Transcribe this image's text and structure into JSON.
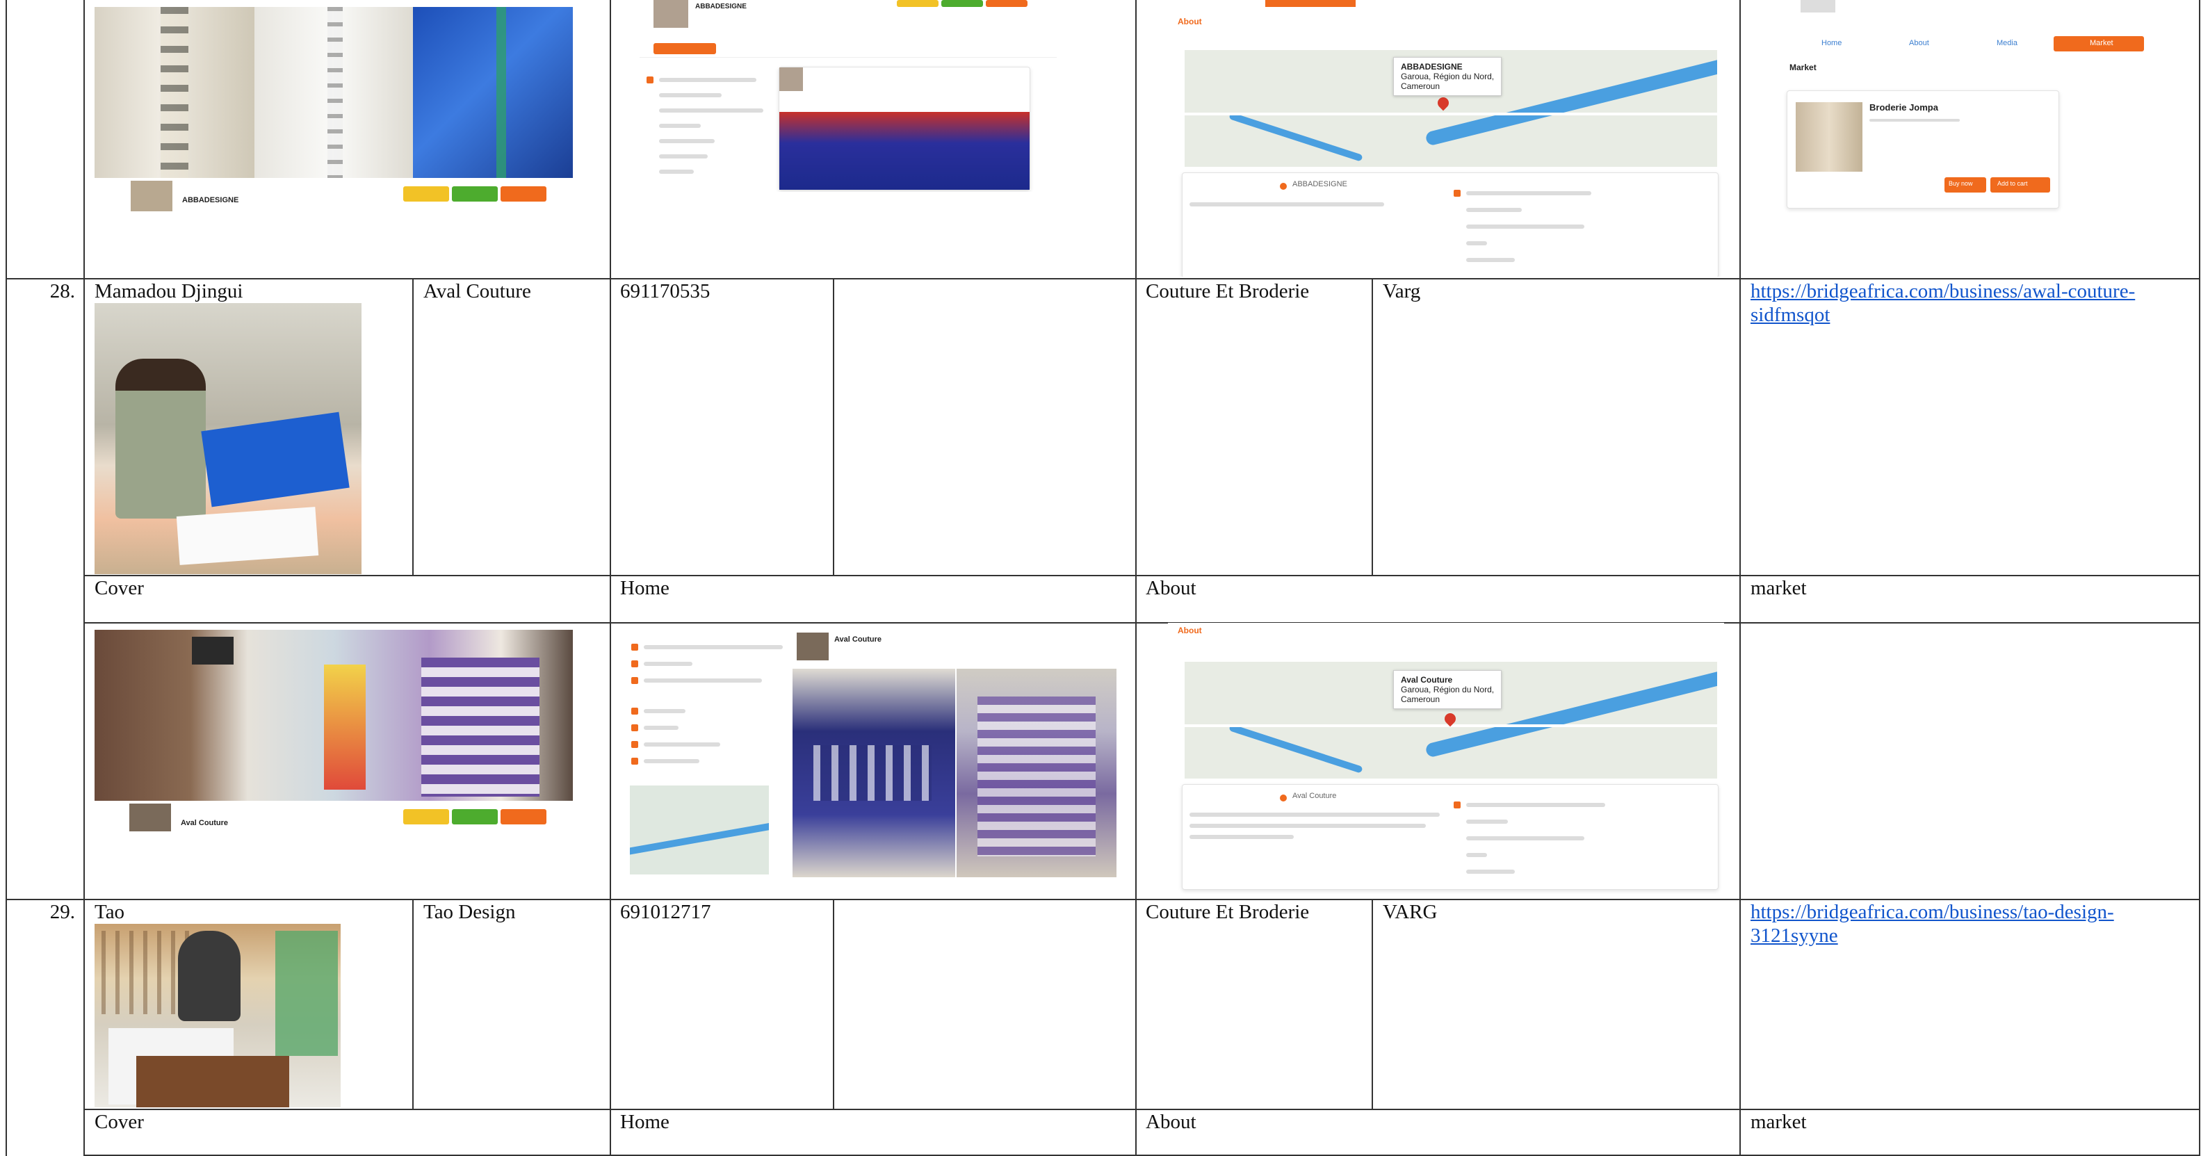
{
  "rows": [
    {
      "number": "28.",
      "name": "Mamadou Djingui",
      "business": "Aval Couture",
      "phone": "691170535",
      "category": "Couture Et Broderie",
      "group": "Varg",
      "link": "https://bridgeafrica.com/business/awal-couture-sidfmsqot",
      "link_line1": "https://bridgeafrica.com/business/awal-couture-",
      "link_line2": "sidfmsqot"
    },
    {
      "number": "29.",
      "name": "Tao",
      "business": "Tao Design",
      "phone": "691012717",
      "category": "Couture Et Broderie",
      "group": "VARG",
      "link": "https://bridgeafrica.com/business/tao-design-3121syyne",
      "link_line1": "https://bridgeafrica.com/business/tao-design-",
      "link_line2": "3121syyne"
    }
  ],
  "section_labels": {
    "cover": "Cover",
    "home": "Home",
    "about": "About",
    "market": "market"
  },
  "top_screens": {
    "cover_business": "ABBADESIGNE",
    "home_business": "ABBADESIGNE",
    "about_heading": "About",
    "about_bubble_name": "ABBADESIGNE",
    "about_bubble_line1": "Garoua, Région du Nord,",
    "about_bubble_line2": "Cameroun",
    "about_city": "ABBADESIGNE",
    "market_tabs": [
      "Home",
      "About",
      "Media",
      "Market"
    ],
    "market_heading": "Market",
    "market_item_title": "Broderie Jompa",
    "market_buy": "Buy now",
    "market_cart": "Add to cart"
  },
  "aval_screens": {
    "cover_business": "Aval Couture",
    "home_business": "Aval Couture",
    "about_heading": "About",
    "about_bubble_name": "Aval Couture",
    "about_bubble_line1": "Garoua, Région du Nord,",
    "about_bubble_line2": "Cameroun",
    "about_city": "Aval Couture"
  }
}
